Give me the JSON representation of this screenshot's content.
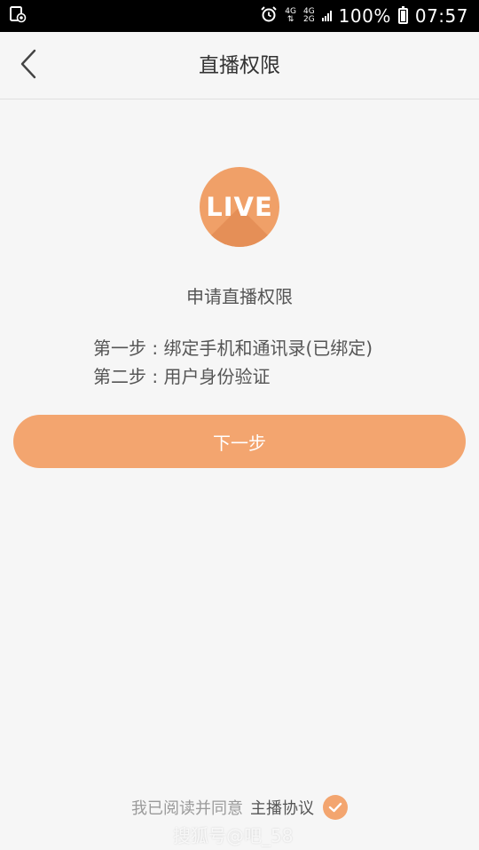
{
  "status_bar": {
    "network_1": "4G",
    "network_2_top": "4G",
    "network_2_bottom": "2G",
    "battery": "100%",
    "time": "07:57",
    "icons": [
      "screen-record-icon",
      "alarm-icon",
      "signal-icon",
      "battery-icon"
    ]
  },
  "nav": {
    "title": "直播权限",
    "back_icon": "chevron-left-icon"
  },
  "logo": {
    "text": "LIVE",
    "color": "#f0a068"
  },
  "content": {
    "apply_title": "申请直播权限",
    "steps": [
      "第一步 : 绑定手机和通讯录(已绑定)",
      "第二步 : 用户身份验证"
    ]
  },
  "next_button": {
    "label": "下一步",
    "color": "#f3a56f"
  },
  "agreement": {
    "text": "我已阅读并同意",
    "link": "主播协议",
    "checked": true,
    "check_icon": "check-circle-icon"
  },
  "watermark": "搜狐号@吧_58"
}
